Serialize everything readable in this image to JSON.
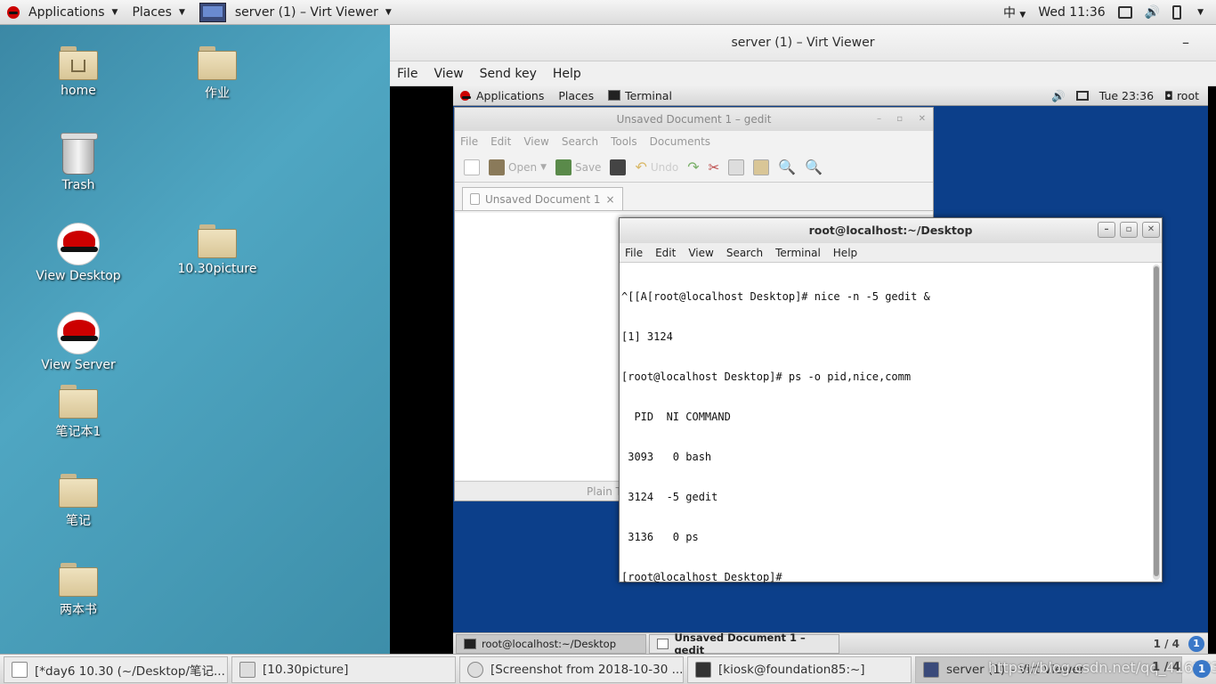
{
  "host_topbar": {
    "applications": "Applications",
    "places": "Places",
    "active_app": "server (1) – Virt Viewer",
    "input_method": "中",
    "clock": "Wed 11:36"
  },
  "desktop": {
    "icons": [
      {
        "label": "home"
      },
      {
        "label": "作业"
      },
      {
        "label": "Trash"
      },
      {
        "label": "View Desktop"
      },
      {
        "label": "10.30picture"
      },
      {
        "label": "View Server"
      },
      {
        "label": "笔记本1"
      },
      {
        "label": "笔记"
      },
      {
        "label": "两本书"
      }
    ]
  },
  "virt_viewer": {
    "title": "server (1) – Virt Viewer",
    "minimize": "–",
    "menu": [
      "File",
      "View",
      "Send key",
      "Help"
    ]
  },
  "guest_panel": {
    "applications": "Applications",
    "places": "Places",
    "terminal": "Terminal",
    "clock": "Tue 23:36",
    "user": "root"
  },
  "gedit": {
    "title": "Unsaved Document 1 – gedit",
    "menu": [
      "File",
      "Edit",
      "View",
      "Search",
      "Tools",
      "Documents"
    ],
    "toolbar": {
      "open": "Open",
      "save": "Save",
      "undo": "Undo"
    },
    "tab_label": "Unsaved Document 1",
    "tab_close": "×",
    "status": "Plain T"
  },
  "terminal": {
    "title": "root@localhost:~/Desktop",
    "menu": [
      "File",
      "Edit",
      "View",
      "Search",
      "Terminal",
      "Help"
    ],
    "lines": [
      "^[[A[root@localhost Desktop]# nice -n -5 gedit &",
      "[1] 3124",
      "[root@localhost Desktop]# ps -o pid,nice,comm",
      "  PID  NI COMMAND",
      " 3093   0 bash",
      " 3124  -5 gedit",
      " 3136   0 ps",
      "[root@localhost Desktop]# "
    ]
  },
  "guest_taskbar": {
    "tasks": [
      "root@localhost:~/Desktop",
      "Unsaved Document 1 – gedit"
    ],
    "pager": "1 / 4",
    "info": "1"
  },
  "host_taskbar": {
    "tasks": [
      "[*day6 10.30 (~/Desktop/笔记...",
      "[10.30picture]",
      "[Screenshot from 2018-10-30 ...",
      "[kiosk@foundation85:~]",
      "server (1) – Virt Viewer"
    ],
    "pager": "1 / 4",
    "info": "1",
    "watermark": "https://blog.csdn.net/qq_41627390"
  }
}
